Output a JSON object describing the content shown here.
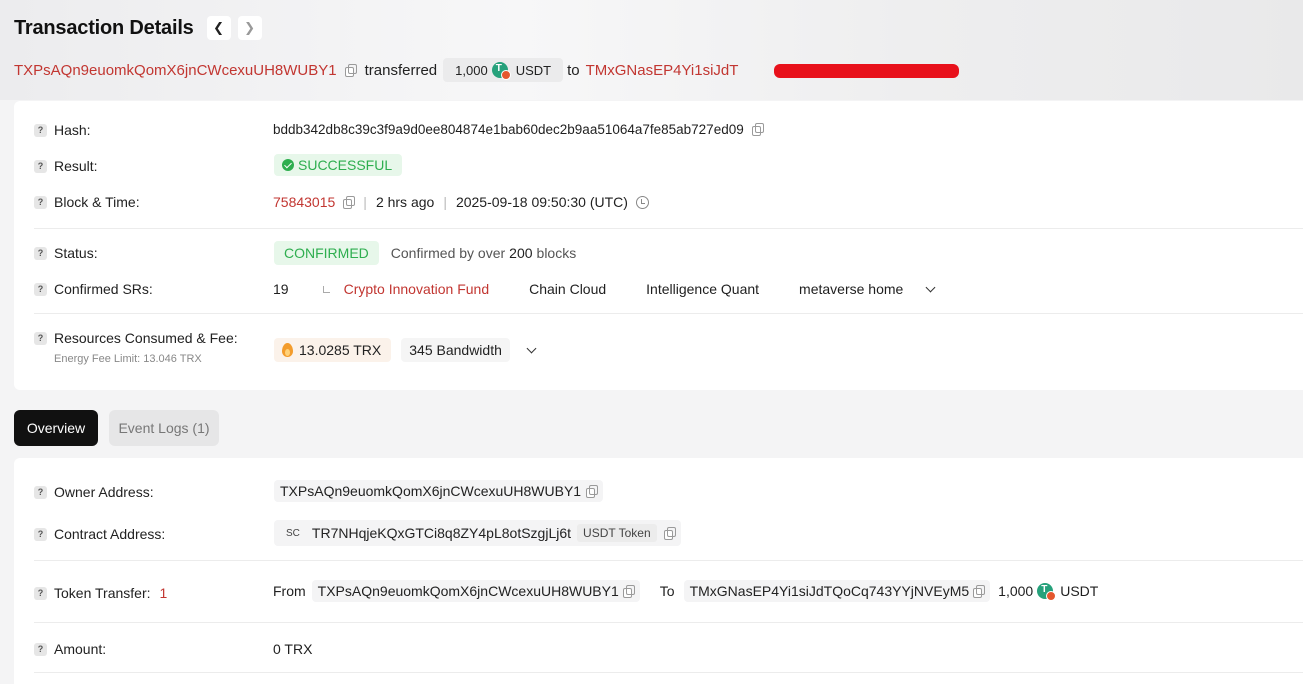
{
  "header": {
    "title": "Transaction Details",
    "prev_icon": "chevron-left-icon",
    "next_icon": "chevron-right-icon"
  },
  "summary": {
    "from_address": "TXPsAQn9euomkQomX6jnCWcexuUH8WUBY1",
    "transferred_word": "transferred",
    "amount": "1,000",
    "token": "USDT",
    "to_word": "to",
    "to_address": "TMxGNasEP4Yi1siJdT"
  },
  "details": {
    "hash_label": "Hash:",
    "hash_value": "bddb342db8c39c3f9a9d0ee804874e1bab60dec2b9aa51064a7fe85ab727ed09",
    "result_label": "Result:",
    "result_value": "SUCCESSFUL",
    "block_label": "Block & Time:",
    "block_number": "75843015",
    "time_ago": "2 hrs ago",
    "timestamp": "2025-09-18 09:50:30 (UTC)",
    "status_label": "Status:",
    "status_value": "CONFIRMED",
    "confirmed_prefix": "Confirmed by over",
    "confirmed_count": "200",
    "confirmed_suffix": "blocks",
    "srs_label": "Confirmed SRs:",
    "srs_count": "19",
    "srs": [
      "Crypto Innovation Fund",
      "Chain Cloud",
      "Intelligence Quant",
      "metaverse home"
    ],
    "resources_label": "Resources Consumed & Fee:",
    "energy_limit": "Energy Fee Limit: 13.046 TRX",
    "fee_trx": "13.0285 TRX",
    "bandwidth": "345 Bandwidth"
  },
  "tabs": {
    "overview": "Overview",
    "event_logs": "Event Logs (1)"
  },
  "overview": {
    "owner_label": "Owner Address:",
    "owner_value": "TXPsAQn9euomkQomX6jnCWcexuUH8WUBY1",
    "contract_label": "Contract Address:",
    "contract_sc": "SC",
    "contract_value": "TR7NHqjeKQxGTCi8q8ZY4pL8otSzgjLj6t",
    "contract_token": "USDT Token",
    "transfer_label": "Token Transfer:",
    "transfer_count": "1",
    "from_word": "From",
    "transfer_from": "TXPsAQn9euomkQomX6jnCWcexuUH8WUBY1",
    "to_word": "To",
    "transfer_to": "TMxGNasEP4Yi1siJdTQoCq743YYjNVEyM5",
    "transfer_amount": "1,000",
    "transfer_token": "USDT",
    "amount_label": "Amount:",
    "amount_value": "0 TRX"
  },
  "colors": {
    "link_red": "#c23631",
    "success_green": "#2eae4f",
    "redaction": "#e8111b"
  }
}
